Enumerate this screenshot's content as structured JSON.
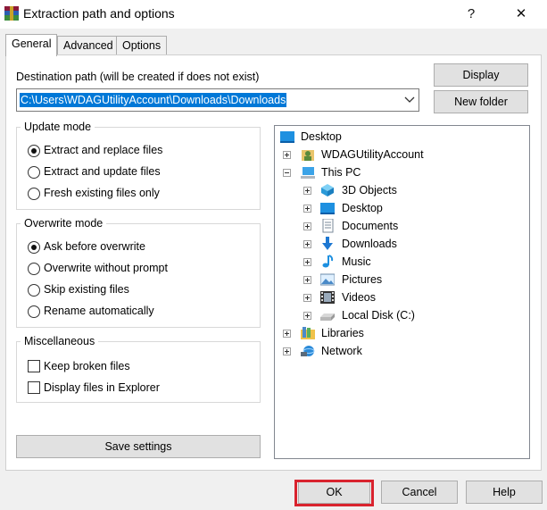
{
  "window": {
    "title": "Extraction path and options",
    "help_glyph": "?",
    "close_glyph": "✕"
  },
  "tabs": [
    {
      "label": "General"
    },
    {
      "label": "Advanced"
    },
    {
      "label": "Options"
    }
  ],
  "destination": {
    "label": "Destination path (will be created if does not exist)",
    "value": "C:\\Users\\WDAGUtilityAccount\\Downloads\\Downloads"
  },
  "buttons": {
    "display": "Display",
    "new_folder": "New folder",
    "save_settings": "Save settings",
    "ok": "OK",
    "cancel": "Cancel",
    "help": "Help"
  },
  "update_mode": {
    "title": "Update mode",
    "options": [
      {
        "label": "Extract and replace files",
        "checked": true
      },
      {
        "label": "Extract and update files",
        "checked": false
      },
      {
        "label": "Fresh existing files only",
        "checked": false
      }
    ]
  },
  "overwrite_mode": {
    "title": "Overwrite mode",
    "options": [
      {
        "label": "Ask before overwrite",
        "checked": true
      },
      {
        "label": "Overwrite without prompt",
        "checked": false
      },
      {
        "label": "Skip existing files",
        "checked": false
      },
      {
        "label": "Rename automatically",
        "checked": false
      }
    ]
  },
  "miscellaneous": {
    "title": "Miscellaneous",
    "options": [
      {
        "label": "Keep broken files",
        "checked": false
      },
      {
        "label": "Display files in Explorer",
        "checked": false
      }
    ]
  },
  "tree": {
    "items": [
      {
        "label": "Desktop",
        "icon": "desktop-icon"
      },
      {
        "label": "WDAGUtilityAccount",
        "icon": "user-folder-icon"
      },
      {
        "label": "This PC",
        "icon": "computer-icon"
      },
      {
        "label": "3D Objects",
        "icon": "3d-objects-icon"
      },
      {
        "label": "Desktop",
        "icon": "desktop-icon"
      },
      {
        "label": "Documents",
        "icon": "documents-icon"
      },
      {
        "label": "Downloads",
        "icon": "downloads-icon"
      },
      {
        "label": "Music",
        "icon": "music-icon"
      },
      {
        "label": "Pictures",
        "icon": "pictures-icon"
      },
      {
        "label": "Videos",
        "icon": "videos-icon"
      },
      {
        "label": "Local Disk (C:)",
        "icon": "local-disk-icon"
      },
      {
        "label": "Libraries",
        "icon": "libraries-icon"
      },
      {
        "label": "Network",
        "icon": "network-icon"
      }
    ]
  },
  "colors": {
    "highlight": "#0078d7",
    "ok_outline": "#d9232e",
    "folder_blue": "#1e90e0"
  }
}
